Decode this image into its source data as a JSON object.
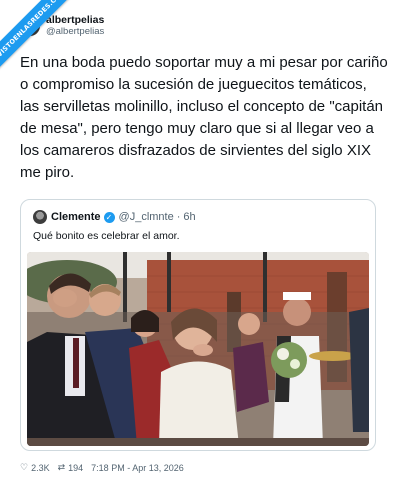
{
  "watermark": {
    "text": "VISTOENLASREDES.COM"
  },
  "tweet": {
    "display_name": "albertpelias",
    "handle": "@albertpelias",
    "text": "En una boda puedo soportar muy a mi pesar por cariño o compromiso la sucesión de jueguecitos temáticos, las servilletas molinillo, incluso el concepto de \"capitán de mesa\", pero tengo muy claro que si al llegar veo a los camareros disfrazados de sirvientes del siglo XIX me piro."
  },
  "quoted_tweet": {
    "display_name": "Clemente",
    "verified_glyph": "✓",
    "handle": "@J_clmnte",
    "separator": "·",
    "time": "6h",
    "text": "Qué bonito es celebrar el amor.",
    "image": {
      "icon": "wedding-photo"
    }
  },
  "footer": {
    "likes": "2.3K",
    "retweets": "194",
    "timestamp": "7:18 PM - Apr 13, 2026"
  },
  "colors": {
    "accent": "#1d9bf0",
    "text": "#0f1419",
    "muted": "#536471",
    "border": "#cfd9de"
  }
}
